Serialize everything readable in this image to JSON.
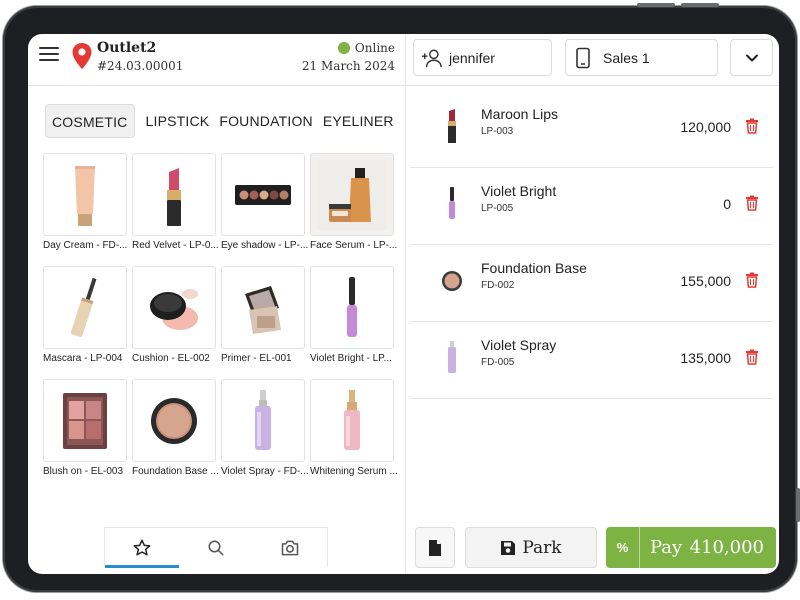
{
  "header": {
    "outlet_name": "Outlet2",
    "outlet_code": "#24.03.00001",
    "status": "Online",
    "status_color": "#7cb342",
    "date": "21 March 2024"
  },
  "categories": [
    {
      "label": "COSMETIC",
      "active": true
    },
    {
      "label": "LIPSTICK",
      "active": false
    },
    {
      "label": "FOUNDATION",
      "active": false
    },
    {
      "label": "EYELINER",
      "active": false
    }
  ],
  "products": [
    {
      "label": "Day Cream  -  FD-...",
      "icon": "tube-icon"
    },
    {
      "label": "Red Velvet  -  LP-0...",
      "icon": "lipstick-icon"
    },
    {
      "label": "Eye shadow  -  LP-...",
      "icon": "eyeshadow-palette-icon"
    },
    {
      "label": "Face Serum  -  LP-...",
      "icon": "serum-bottle-icon"
    },
    {
      "label": "Mascara  -  LP-004",
      "icon": "mascara-icon"
    },
    {
      "label": "Cushion  -  EL-002",
      "icon": "cushion-compact-icon"
    },
    {
      "label": "Primer  -  EL-001",
      "icon": "primer-compact-icon"
    },
    {
      "label": "Violet Bright  -  LP...",
      "icon": "lipgloss-icon"
    },
    {
      "label": "Blush on  -  EL-003",
      "icon": "blush-palette-icon"
    },
    {
      "label": "Foundation Base ...",
      "icon": "powder-compact-icon"
    },
    {
      "label": "Violet Spray  -  FD-...",
      "icon": "spray-bottle-icon"
    },
    {
      "label": "Whitening Serum ...",
      "icon": "serum-bottle-icon"
    }
  ],
  "bottom_tabs": [
    {
      "icon": "star-icon",
      "active": true
    },
    {
      "icon": "search-icon",
      "active": false
    },
    {
      "icon": "camera-icon",
      "active": false
    }
  ],
  "customer": {
    "name": "jennifer",
    "icon": "add-user-icon"
  },
  "register": {
    "name": "Sales 1",
    "icon": "tablet-icon"
  },
  "cart": [
    {
      "name": "Maroon Lips",
      "code": "LP-003",
      "price": "120,000",
      "icon": "lipstick-icon"
    },
    {
      "name": "Violet Bright",
      "code": "LP-005",
      "price": "0",
      "icon": "lipgloss-icon"
    },
    {
      "name": "Foundation Base",
      "code": "FD-002",
      "price": "155,000",
      "icon": "powder-compact-icon"
    },
    {
      "name": "Violet Spray",
      "code": "FD-005",
      "price": "135,000",
      "icon": "spray-bottle-icon"
    }
  ],
  "footer": {
    "park_label": "Park",
    "discount_label": "%",
    "pay_label": "Pay",
    "pay_total": "410,000",
    "pay_color": "#7cb342",
    "delete_color": "#e53935"
  }
}
